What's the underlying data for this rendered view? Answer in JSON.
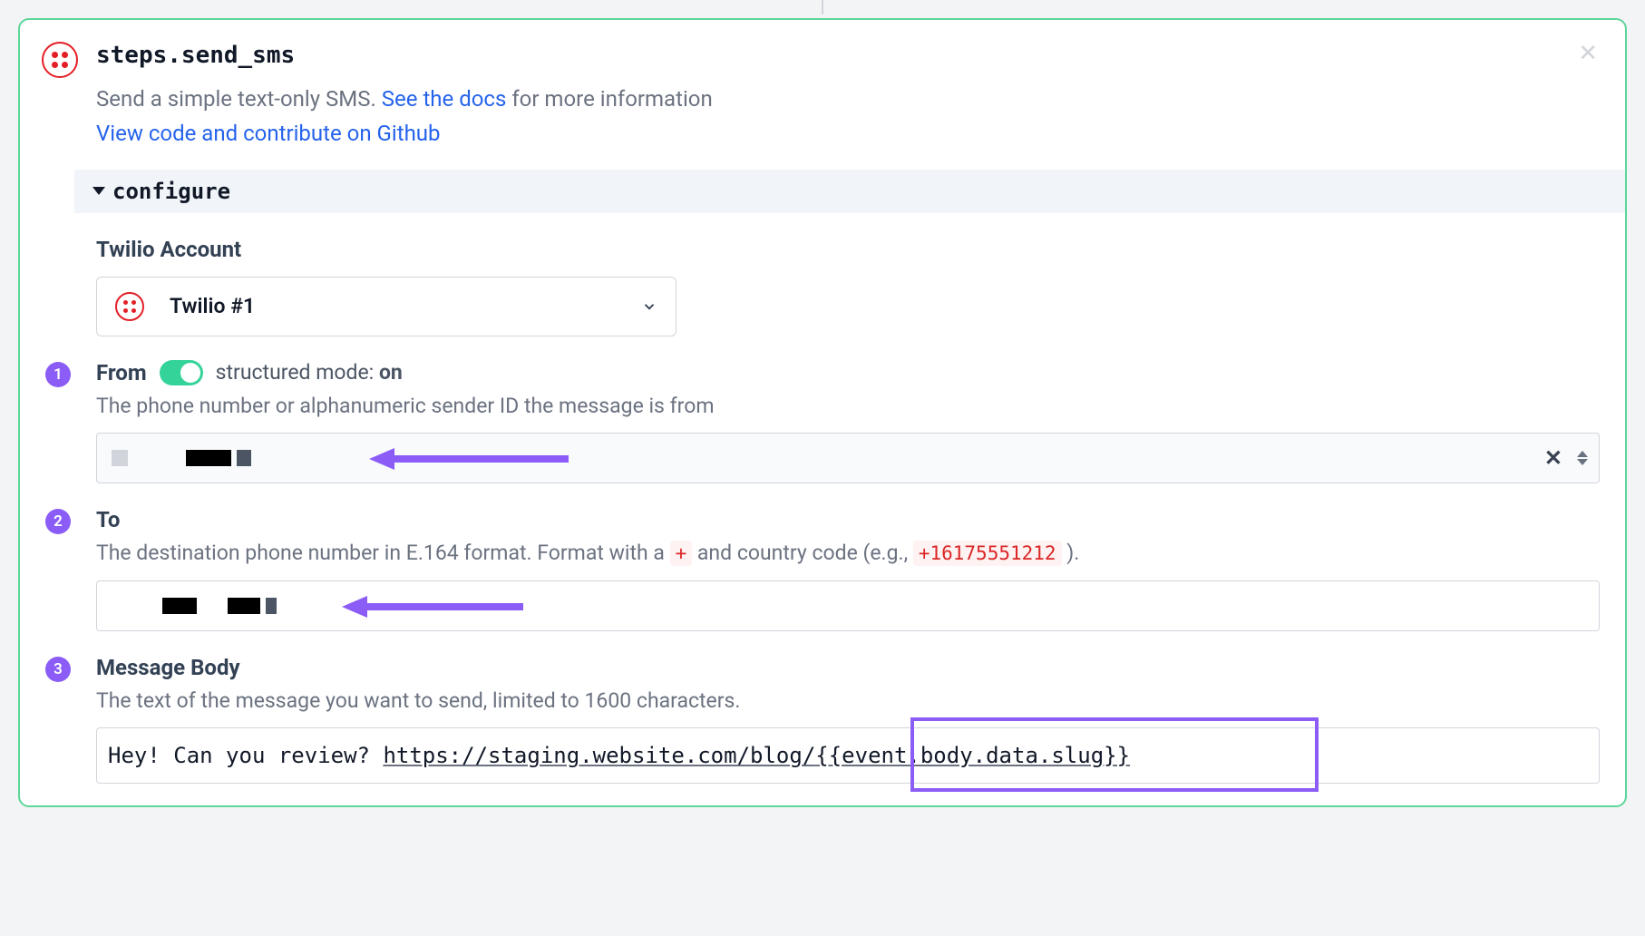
{
  "step": {
    "title": "steps.send_sms",
    "desc_pre": "Send a simple text-only SMS. ",
    "desc_link": "See the docs",
    "desc_post": " for more information",
    "github_link": "View code and contribute on Github"
  },
  "configure": {
    "label": "configure"
  },
  "account": {
    "label": "Twilio Account",
    "selected": "Twilio #1"
  },
  "from": {
    "label": "From",
    "mode_text": "structured mode: ",
    "mode_state": "on",
    "help": "The phone number or alphanumeric sender ID the message is from"
  },
  "to": {
    "label": "To",
    "help_pre": "The destination phone number in E.164 format. Format with a ",
    "help_code1": "+",
    "help_mid": " and country code (e.g., ",
    "help_code2": "+16175551212",
    "help_post": " )."
  },
  "body": {
    "label": "Message Body",
    "help": "The text of the message you want to send, limited to 1600 characters.",
    "text_pre": "Hey! Can you review? ",
    "text_url_base": "https://staging.website.com/blog/",
    "text_url_var": "{{event.body.data.slug}}"
  },
  "badges": [
    "1",
    "2",
    "3"
  ]
}
